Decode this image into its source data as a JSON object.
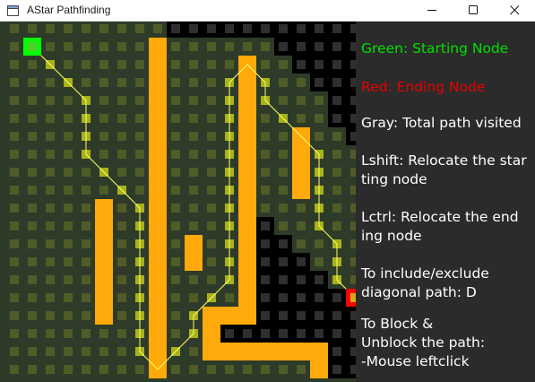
{
  "window": {
    "title": "AStar Pathfinding",
    "controls": [
      "minimize",
      "maximize",
      "close"
    ]
  },
  "grid": {
    "cols": 20,
    "rows": 20,
    "colors": {
      "background": "#2e3b28",
      "empty_cell": "#4f5c28",
      "wall": "#ffa90a",
      "visited_background": "#000000",
      "visited_cell": "#2f2f2f",
      "path_cell": "#a7b21c",
      "path_line": "#ffff60",
      "start": "#00ff00",
      "end": "#ff0000"
    },
    "start": [
      1,
      1
    ],
    "end": [
      19,
      15
    ],
    "walls": [
      [
        8,
        1
      ],
      [
        8,
        2
      ],
      [
        8,
        3
      ],
      [
        8,
        4
      ],
      [
        8,
        5
      ],
      [
        8,
        6
      ],
      [
        8,
        7
      ],
      [
        8,
        8
      ],
      [
        8,
        9
      ],
      [
        8,
        10
      ],
      [
        8,
        11
      ],
      [
        8,
        12
      ],
      [
        8,
        13
      ],
      [
        8,
        14
      ],
      [
        8,
        15
      ],
      [
        8,
        16
      ],
      [
        8,
        17
      ],
      [
        8,
        18
      ],
      [
        8,
        19
      ],
      [
        13,
        2
      ],
      [
        13,
        3
      ],
      [
        13,
        4
      ],
      [
        13,
        5
      ],
      [
        13,
        6
      ],
      [
        13,
        7
      ],
      [
        13,
        8
      ],
      [
        13,
        9
      ],
      [
        13,
        10
      ],
      [
        13,
        11
      ],
      [
        13,
        12
      ],
      [
        13,
        13
      ],
      [
        13,
        14
      ],
      [
        13,
        15
      ],
      [
        13,
        16
      ],
      [
        16,
        6
      ],
      [
        16,
        7
      ],
      [
        16,
        8
      ],
      [
        16,
        9
      ],
      [
        5,
        10
      ],
      [
        5,
        11
      ],
      [
        5,
        12
      ],
      [
        5,
        13
      ],
      [
        5,
        14
      ],
      [
        5,
        15
      ],
      [
        5,
        16
      ],
      [
        10,
        12
      ],
      [
        10,
        13
      ],
      [
        11,
        16
      ],
      [
        12,
        16
      ],
      [
        11,
        17
      ],
      [
        11,
        18
      ],
      [
        12,
        18
      ],
      [
        13,
        18
      ],
      [
        14,
        18
      ],
      [
        15,
        18
      ],
      [
        16,
        18
      ],
      [
        17,
        18
      ],
      [
        17,
        19
      ]
    ],
    "visited": [
      [
        9,
        0
      ],
      [
        10,
        0
      ],
      [
        11,
        0
      ],
      [
        12,
        0
      ],
      [
        13,
        0
      ],
      [
        14,
        0
      ],
      [
        15,
        0
      ],
      [
        16,
        0
      ],
      [
        17,
        0
      ],
      [
        18,
        0
      ],
      [
        19,
        0
      ],
      [
        15,
        1
      ],
      [
        16,
        1
      ],
      [
        17,
        1
      ],
      [
        18,
        1
      ],
      [
        19,
        1
      ],
      [
        16,
        2
      ],
      [
        17,
        2
      ],
      [
        18,
        2
      ],
      [
        19,
        2
      ],
      [
        17,
        3
      ],
      [
        18,
        3
      ],
      [
        19,
        3
      ],
      [
        18,
        4
      ],
      [
        19,
        4
      ],
      [
        18,
        5
      ],
      [
        19,
        5
      ],
      [
        19,
        6
      ],
      [
        14,
        11
      ],
      [
        14,
        12
      ],
      [
        15,
        12
      ],
      [
        14,
        13
      ],
      [
        15,
        13
      ],
      [
        16,
        13
      ],
      [
        14,
        14
      ],
      [
        15,
        14
      ],
      [
        16,
        14
      ],
      [
        17,
        14
      ],
      [
        14,
        15
      ],
      [
        15,
        15
      ],
      [
        16,
        15
      ],
      [
        17,
        15
      ],
      [
        18,
        15
      ],
      [
        14,
        16
      ],
      [
        15,
        16
      ],
      [
        16,
        16
      ],
      [
        17,
        16
      ],
      [
        18,
        16
      ],
      [
        19,
        16
      ],
      [
        12,
        17
      ],
      [
        13,
        17
      ],
      [
        14,
        17
      ],
      [
        15,
        17
      ],
      [
        16,
        17
      ],
      [
        17,
        17
      ],
      [
        18,
        17
      ],
      [
        19,
        17
      ],
      [
        18,
        18
      ],
      [
        19,
        18
      ],
      [
        18,
        19
      ],
      [
        19,
        19
      ]
    ],
    "path": [
      [
        1,
        1
      ],
      [
        2,
        2
      ],
      [
        3,
        3
      ],
      [
        4,
        4
      ],
      [
        4,
        5
      ],
      [
        4,
        6
      ],
      [
        4,
        7
      ],
      [
        5,
        8
      ],
      [
        6,
        9
      ],
      [
        7,
        10
      ],
      [
        7,
        11
      ],
      [
        7,
        12
      ],
      [
        7,
        13
      ],
      [
        7,
        14
      ],
      [
        7,
        15
      ],
      [
        7,
        16
      ],
      [
        7,
        17
      ],
      [
        7,
        18
      ],
      [
        8,
        19
      ],
      [
        9,
        18
      ],
      [
        10,
        17
      ],
      [
        10,
        16
      ],
      [
        11,
        15
      ],
      [
        12,
        14
      ],
      [
        12,
        13
      ],
      [
        12,
        12
      ],
      [
        12,
        11
      ],
      [
        12,
        10
      ],
      [
        12,
        9
      ],
      [
        12,
        8
      ],
      [
        12,
        7
      ],
      [
        12,
        6
      ],
      [
        12,
        5
      ],
      [
        12,
        4
      ],
      [
        12,
        3
      ],
      [
        13,
        2
      ],
      [
        14,
        3
      ],
      [
        14,
        4
      ],
      [
        15,
        5
      ],
      [
        16,
        6
      ],
      [
        17,
        7
      ],
      [
        17,
        8
      ],
      [
        17,
        9
      ],
      [
        17,
        10
      ],
      [
        17,
        11
      ],
      [
        18,
        12
      ],
      [
        18,
        13
      ],
      [
        18,
        14
      ],
      [
        19,
        15
      ]
    ]
  },
  "info": {
    "lines": [
      {
        "text": "Green: Starting Node",
        "color": "#00e000"
      },
      {
        "text": "Red: Ending Node",
        "color": "#e60000"
      },
      {
        "text": "Gray: Total path visited",
        "color": "#ffffff"
      },
      {
        "text": "Lshift: Relocate the star\nting node",
        "color": "#ffffff"
      },
      {
        "text": "Lctrl: Relocate the end\ning node",
        "color": "#ffffff"
      },
      {
        "text": "To include/exclude\ndiagonal path: D",
        "color": "#ffffff"
      },
      {
        "text": "To Block &\nUnblock the path:\n-Mouse leftclick",
        "color": "#ffffff"
      }
    ]
  }
}
